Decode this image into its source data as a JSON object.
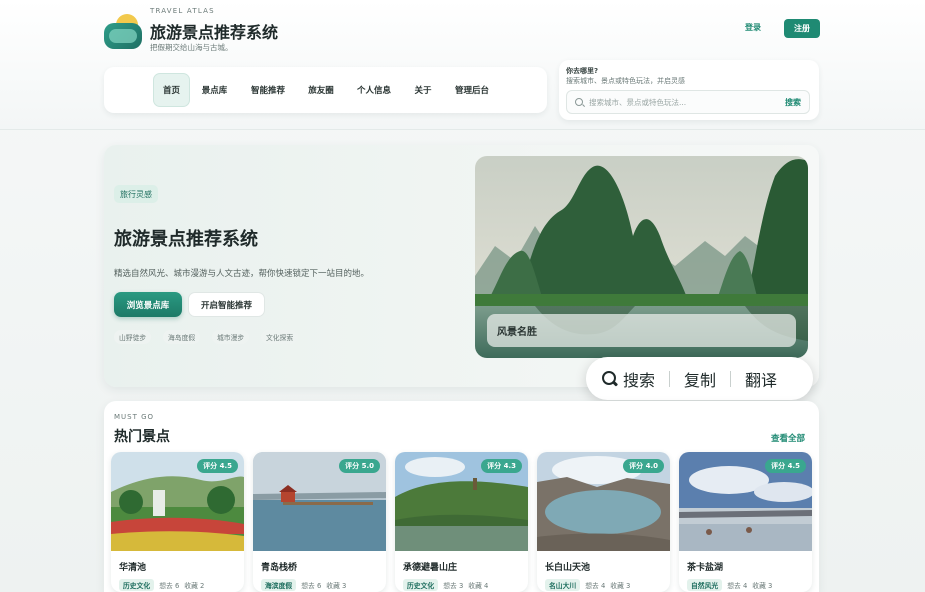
{
  "brand": {
    "overline": "TRAVEL ATLAS",
    "title": "旅游景点推荐系统",
    "desc": "把假期交给山海与古城。"
  },
  "auth": {
    "login": "登录",
    "register": "注册"
  },
  "nav": {
    "items": [
      {
        "label": "首页",
        "active": true
      },
      {
        "label": "景点库"
      },
      {
        "label": "智能推荐"
      },
      {
        "label": "旅友圈"
      },
      {
        "label": "个人信息"
      },
      {
        "label": "关于"
      },
      {
        "label": "管理后台"
      }
    ]
  },
  "search": {
    "question": "你去哪里?",
    "hint": "搜索城市、景点或特色玩法，并启灵感",
    "placeholder": "搜索城市、景点或特色玩法...",
    "button": "搜索"
  },
  "hero": {
    "tag": "旅行灵感",
    "title": "旅游景点推荐系统",
    "desc": "精选自然风光、城市漫游与人文古迹，帮你快速锁定下一站目的地。",
    "primary_button": "浏览景点库",
    "secondary_button": "开启智能推荐",
    "chips": [
      "山野徒步",
      "海岛度假",
      "城市漫步",
      "文化探索"
    ],
    "image_caption": "风景名胜"
  },
  "floating_toolbar": {
    "search": "搜索",
    "copy": "复制",
    "translate": "翻译"
  },
  "popular": {
    "overline": "MUST GO",
    "title": "热门景点",
    "view_all": "查看全部",
    "cards": [
      {
        "name": "华清池",
        "rating": "评分 4.5",
        "tag": "历史文化",
        "visits": "想去 6",
        "favorites": "收藏 2"
      },
      {
        "name": "青岛栈桥",
        "rating": "评分 5.0",
        "tag": "海滨度假",
        "visits": "想去 6",
        "favorites": "收藏 3"
      },
      {
        "name": "承德避暑山庄",
        "rating": "评分 4.3",
        "tag": "历史文化",
        "visits": "想去 3",
        "favorites": "收藏 4"
      },
      {
        "name": "长白山天池",
        "rating": "评分 4.0",
        "tag": "名山大川",
        "visits": "想去 4",
        "favorites": "收藏 3"
      },
      {
        "name": "茶卡盐湖",
        "rating": "评分 4.5",
        "tag": "自然风光",
        "visits": "想去 4",
        "favorites": "收藏 3"
      }
    ]
  },
  "colors": {
    "accent": "#1f8a73",
    "rating_badge": "#3aa78f"
  }
}
